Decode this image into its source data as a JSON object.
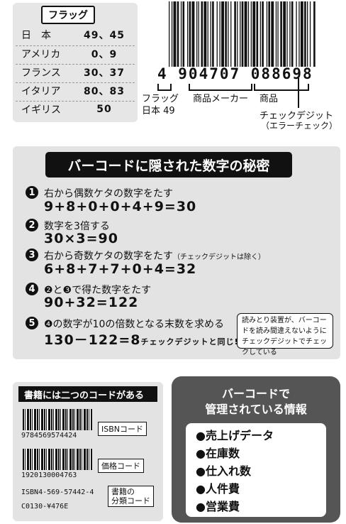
{
  "flags": {
    "title": "フラッグ",
    "rows": [
      {
        "country": "日　本",
        "code": "49、45"
      },
      {
        "country": "アメリカ",
        "code": "0、9"
      },
      {
        "country": "フランス",
        "code": "30、37"
      },
      {
        "country": "イタリア",
        "code": "80、83"
      },
      {
        "country": "イギリス",
        "code": "50"
      }
    ]
  },
  "barcode": {
    "digits": "4 904707 088698",
    "label_flag": "フラッグ",
    "label_flag_value": "日本 49",
    "label_maker": "商品メーカー",
    "label_product": "商品",
    "label_check": "チェックデジット",
    "label_check_sub": "（エラーチェック）"
  },
  "secret": {
    "title": "バーコードに隠された数字の秘密",
    "steps": [
      {
        "num": "1",
        "text": "右から偶数ケタの数字をたす",
        "eq": "9+8+0+0+4+9=30"
      },
      {
        "num": "2",
        "text": "数字を3倍する",
        "eq": "30×3=90"
      },
      {
        "num": "3",
        "text": "右から奇数ケタの数字をたす",
        "note": "（チェックデジットは除く）",
        "eq": "6+8+7+7+0+4=32"
      },
      {
        "num": "4",
        "text": "❷と❸で得た数字をたす",
        "eq": "90+32=122"
      },
      {
        "num": "5",
        "text": "❹の数字が10の倍数となる末数を求める",
        "eq": "130－122=8",
        "eq_note": "チェックデジットと同じ!"
      }
    ],
    "note": "読みとり装置が、バーコードを読み間違えないようにチェックデジットでチェックしている"
  },
  "books": {
    "title": "書籍には二つのコードがある",
    "code1": "9784569574424",
    "tag1": "ISBNコード",
    "code2": "1920130004763",
    "tag2": "価格コード",
    "isbn_line": "ISBN4-569-57442-4",
    "class_line": "C0130-¥476E",
    "tag3a": "書籍の",
    "tag3b": "分類コード"
  },
  "info": {
    "title_1": "バーコードで",
    "title_2": "管理されている情報",
    "items": [
      "●売上げデータ",
      "●在庫数",
      "●仕入れ数",
      "●人件費",
      "●営業費"
    ]
  }
}
